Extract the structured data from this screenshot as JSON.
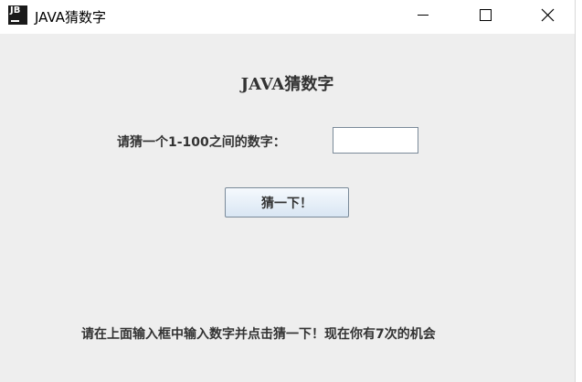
{
  "window": {
    "title": "JAVA猜数字",
    "icon_label": "JB",
    "icon_name": "jetbrains-app-icon",
    "controls": {
      "minimize_icon": "minimize-icon",
      "maximize_icon": "maximize-icon",
      "close_icon": "close-icon"
    }
  },
  "main": {
    "heading": "JAVA猜数字",
    "prompt_label": "请猜一个1-100之间的数字：",
    "guess_input_value": "",
    "guess_button_label": "猜一下！",
    "status_text": "请在上面输入框中输入数字并点击猜一下！现在你有7次的机会"
  },
  "colors": {
    "content_background": "#eeeeee",
    "titlebar_background": "#ffffff",
    "text": "#333333",
    "button_gradient_top": "#f5f9fd",
    "button_gradient_bottom": "#d9e6f3",
    "border": "#7a8a99"
  }
}
